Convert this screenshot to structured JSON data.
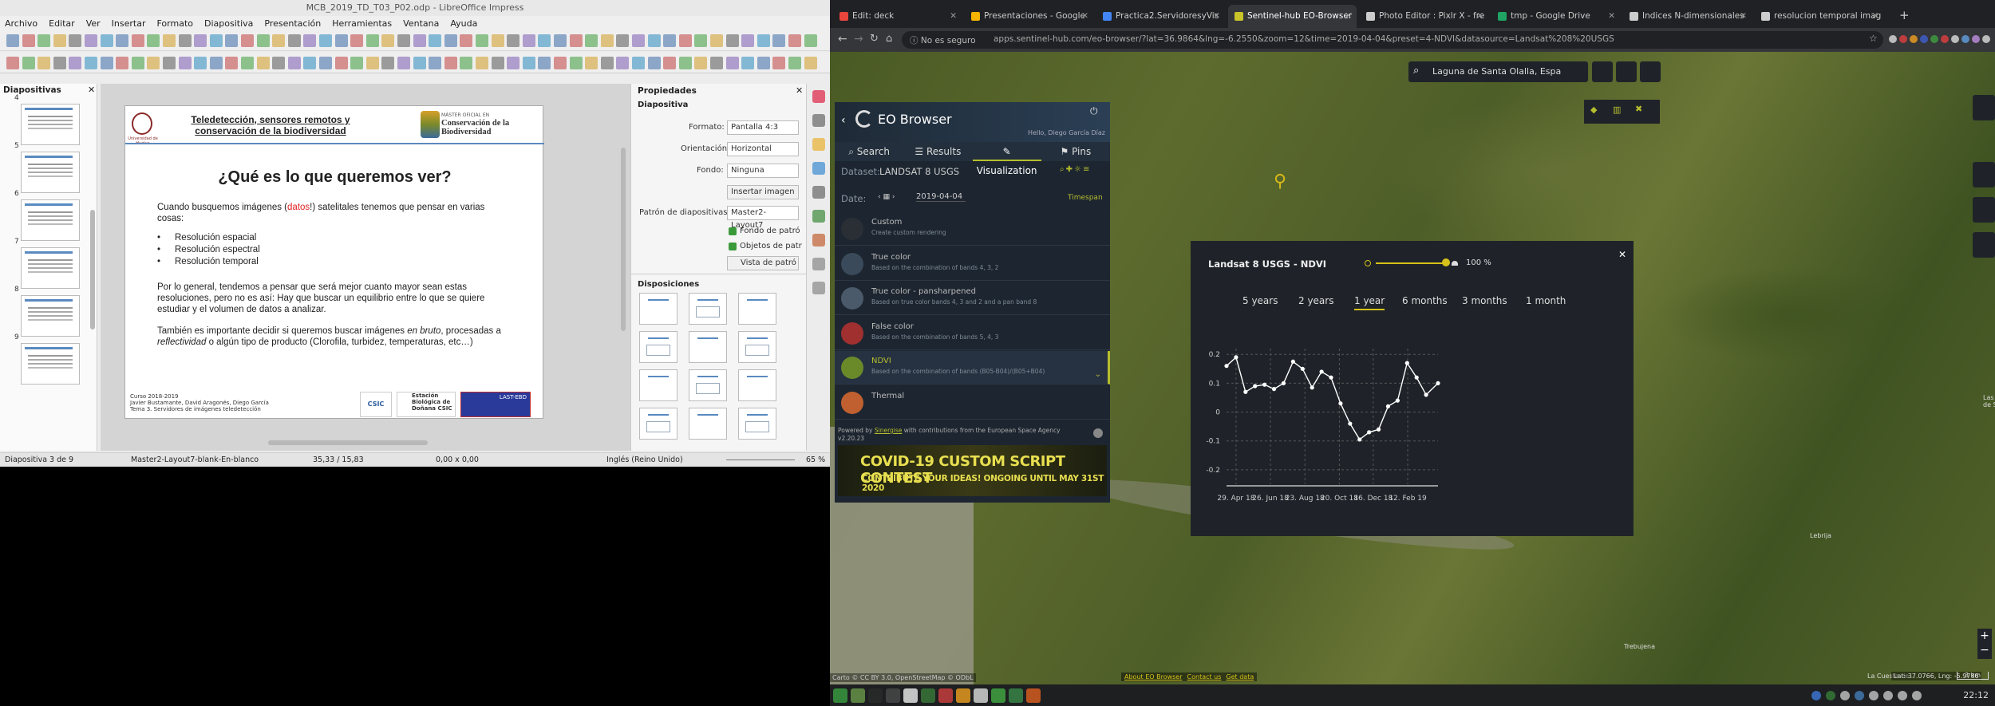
{
  "impress": {
    "window_title": "MCB_2019_TD_T03_P02.odp - LibreOffice Impress",
    "menu": [
      "Archivo",
      "Editar",
      "Ver",
      "Insertar",
      "Formato",
      "Diapositiva",
      "Presentación",
      "Herramientas",
      "Ventana",
      "Ayuda"
    ],
    "slides_panel_title": "Diapositivas",
    "slide_numbers": [
      "4",
      "5",
      "6",
      "7",
      "8",
      "9"
    ],
    "slide": {
      "header": "Teledetección, sensores remotos y conservación de la biodiversidad",
      "master_small": "MÁSTER OFICIAL EN",
      "master_big": "Conservación de la Biodiversidad",
      "univ": "Universidad de Huelva",
      "title": "¿Qué es lo que queremos ver?",
      "p1a": "Cuando busquemos imágenes (",
      "p1b": "datos",
      "p1c": "!) satelitales tenemos que pensar en varias cosas:",
      "bullets": [
        "Resolución espacial",
        "Resolución espectral",
        "Resolución temporal"
      ],
      "p2": "Por lo general, tendemos a pensar que será mejor cuanto mayor sean estas resoluciones, pero no es así: Hay que buscar un equilibrio entre lo que se quiere estudiar y el volumen de datos a analizar.",
      "p3a": "También es importante decidir si queremos buscar imágenes ",
      "p3b": "en bruto",
      "p3c": ", procesadas a ",
      "p3d": "reflectividad",
      "p3e": " o algún tipo de producto (Clorofila, turbidez, temperaturas, etc…)",
      "footer1": "Curso 2018-2019",
      "footer2": "Javier Bustamante, David Aragonés, Diego García",
      "footer3": "Tema 3. Servidores de imágenes teledetección",
      "logo_csic": "CSIC",
      "logo_ebd": "Estación Biológica de Doñana CSIC",
      "logo_last": "LAST-EBD"
    },
    "props": {
      "title": "Propiedades",
      "section": "Diapositiva",
      "format_label": "Formato:",
      "format_value": "Pantalla 4:3",
      "orient_label": "Orientación:",
      "orient_value": "Horizontal",
      "bg_label": "Fondo:",
      "bg_value": "Ninguna",
      "insert_image": "Insertar imagen",
      "master_label": "Patrón de diapositivas:",
      "master_value": "Master2-Layout7",
      "chk1": "Fondo de patró",
      "chk2": "Objetos de patr",
      "master_view": "Vista de patró",
      "layouts": "Disposiciones"
    },
    "status": {
      "slide": "Diapositiva 3 de 9",
      "master": "Master2-Layout7-blank-En-blanco",
      "pos": "35,33 / 15,83",
      "size": "0,00 x 0,00",
      "lang": "Inglés (Reino Unido)",
      "zoom": "65 %"
    }
  },
  "browser": {
    "tabs": [
      {
        "label": "Edit: deck",
        "color": "#e8453c"
      },
      {
        "label": "Presentaciones - Google",
        "color": "#f4b400"
      },
      {
        "label": "Practica2.ServidoresyVis",
        "color": "#4285f4"
      },
      {
        "label": "Sentinel-hub EO-Browser",
        "color": "#c8c42a"
      },
      {
        "label": "Photo Editor : Pixlr X - fre",
        "color": "#cccccc"
      },
      {
        "label": "tmp - Google Drive",
        "color": "#1fa463"
      },
      {
        "label": "Indices N-dimensionales",
        "color": "#cccccc"
      },
      {
        "label": "resolucion temporal imag",
        "color": "#cccccc"
      }
    ],
    "insecure": "No es seguro",
    "url": "apps.sentinel-hub.com/eo-browser/?lat=36.9864&lng=-6.2550&zoom=12&time=2019-04-04&preset=4-NDVI&datasource=Landsat%208%20USGS",
    "search_value": "Laguna de Santa Olalla, Espa"
  },
  "eo": {
    "title": "EO Browser",
    "user": "Hello, Diego García Díaz",
    "nav": [
      "Search",
      "Results",
      "Visualization",
      "Pins"
    ],
    "dataset_label": "Dataset:",
    "dataset": "LANDSAT 8 USGS",
    "date_label": "Date:",
    "date": "2019-04-04",
    "timespan": "Timespan",
    "layers": [
      {
        "name": "Custom",
        "desc": "Create custom rendering",
        "color": "#2a2f36"
      },
      {
        "name": "True color",
        "desc": "Based on the combination of bands 4, 3, 2",
        "color": "#3a4a5a"
      },
      {
        "name": "True color - pansharpened",
        "desc": "Based on true color bands 4, 3 and 2 and a pan band 8",
        "color": "#4a5a6a"
      },
      {
        "name": "False color",
        "desc": "Based on the combination of bands 5, 4, 3",
        "color": "#a03030"
      },
      {
        "name": "NDVI",
        "desc": "Based on the combination of bands (B05-B04)/(B05+B04)",
        "color": "#6a8a2a"
      },
      {
        "name": "Thermal",
        "desc": "",
        "color": "#c06030"
      }
    ],
    "powered_a": "Powered by ",
    "powered_b": "Sinergise",
    "powered_c": " with contributions from the European Space Agency",
    "version": "v2.20.23",
    "contest_title": "COVID-19 CUSTOM SCRIPT CONTEST",
    "contest_sub": "CONTRIBUTE YOUR IDEAS! ONGOING UNTIL MAY 31ST 2020",
    "attribution": "Carto © CC BY 3.0, OpenStreetMap © ODbL",
    "links": [
      "About EO Browser",
      "Contact us",
      "Get data"
    ],
    "scale": "3 km",
    "coords": "Lat: 37.0766, Lng: -5.9786",
    "place1": "Las Cabezas de San Juan",
    "place2": "Lebrija",
    "place3": "Trebujena",
    "place4": "La Cuesta de..."
  },
  "modal": {
    "title": "Landsat 8 USGS - NDVI",
    "opacity": "100 %",
    "periods": [
      "5 years",
      "2 years",
      "1 year",
      "6 months",
      "3 months",
      "1 month"
    ],
    "active_period": "1 year"
  },
  "chart_data": {
    "type": "line",
    "title": "Landsat 8 USGS - NDVI",
    "x_tick_labels": [
      "29. Apr 18",
      "26. Jun 18",
      "23. Aug 18",
      "20. Oct 18",
      "16. Dec 18",
      "12. Feb 19"
    ],
    "y_tick_labels": [
      "-0.2",
      "-0.1",
      "0",
      "0.1",
      "0.2"
    ],
    "ylim": [
      -0.25,
      0.22
    ],
    "xlim": [
      "2018-04-13",
      "2019-04-04"
    ],
    "grid": true,
    "series": [
      {
        "color": "#ffffff",
        "points": [
          [
            "2018-04-13",
            0.16
          ],
          [
            "2018-04-29",
            0.19
          ],
          [
            "2018-05-15",
            0.07
          ],
          [
            "2018-05-31",
            0.09
          ],
          [
            "2018-06-16",
            0.095
          ],
          [
            "2018-07-02",
            0.08
          ],
          [
            "2018-07-18",
            0.1
          ],
          [
            "2018-08-03",
            0.175
          ],
          [
            "2018-08-19",
            0.15
          ],
          [
            "2018-09-04",
            0.085
          ],
          [
            "2018-09-20",
            0.14
          ],
          [
            "2018-10-06",
            0.12
          ],
          [
            "2018-10-22",
            0.03
          ],
          [
            "2018-11-07",
            -0.04
          ],
          [
            "2018-11-23",
            -0.095
          ],
          [
            "2018-12-09",
            -0.07
          ],
          [
            "2018-12-25",
            -0.06
          ],
          [
            "2019-01-10",
            0.02
          ],
          [
            "2019-01-26",
            0.04
          ],
          [
            "2019-02-11",
            0.17
          ],
          [
            "2019-02-27",
            0.12
          ],
          [
            "2019-03-15",
            0.06
          ],
          [
            "2019-04-04",
            0.1
          ]
        ]
      }
    ]
  },
  "taskbar": {
    "clock": "22:12"
  }
}
